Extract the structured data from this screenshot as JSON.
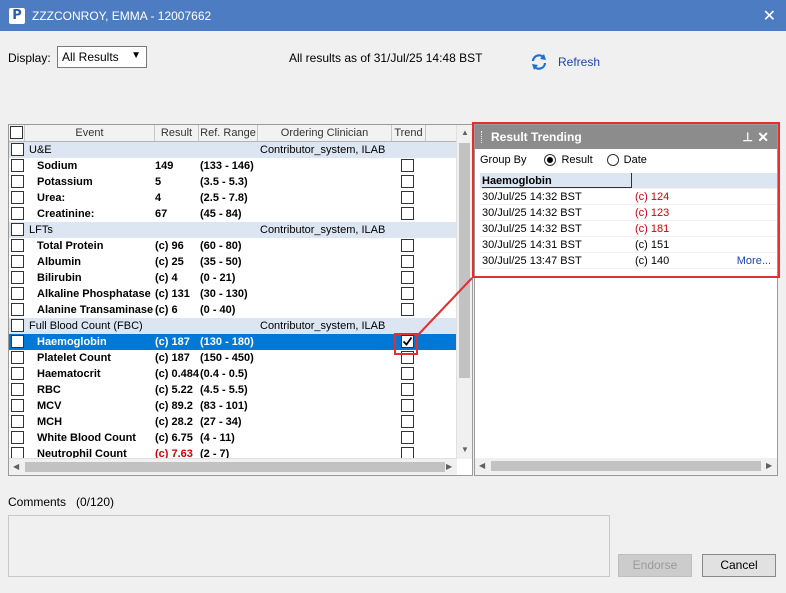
{
  "window": {
    "title": "ZZZCONROY, EMMA  - 12007662",
    "app_icon_letter": "P"
  },
  "display": {
    "label": "Display:",
    "selected": "All Results"
  },
  "status_text": "All results as of 31/Jul/25 14:48 BST",
  "refresh_label": "Refresh",
  "grid": {
    "columns": [
      "Event",
      "Result",
      "Ref. Range",
      "Ordering Clinician",
      "Trend"
    ],
    "rows": [
      {
        "type": "group",
        "event": "U&E",
        "clinician": "Contributor_system, ILAB"
      },
      {
        "type": "item",
        "event": "Sodium",
        "result": "149",
        "range": "(133 - 146)"
      },
      {
        "type": "item",
        "event": "Potassium",
        "result": "5",
        "range": "(3.5 - 5.3)"
      },
      {
        "type": "item",
        "event": "Urea:",
        "result": "4",
        "range": "(2.5 - 7.8)"
      },
      {
        "type": "item",
        "event": "Creatinine:",
        "result": "67",
        "range": "(45 - 84)"
      },
      {
        "type": "group",
        "event": "LFTs",
        "clinician": "Contributor_system, ILAB"
      },
      {
        "type": "item",
        "event": "Total Protein",
        "result": "(c) 96",
        "range": "(60 - 80)"
      },
      {
        "type": "item",
        "event": "Albumin",
        "result": "(c) 25",
        "range": "(35 - 50)"
      },
      {
        "type": "item",
        "event": "Bilirubin",
        "result": "(c) 4",
        "range": "(0 - 21)"
      },
      {
        "type": "item",
        "event": "Alkaline Phosphatase",
        "result": "(c) 131",
        "range": "(30 - 130)"
      },
      {
        "type": "item",
        "event": "Alanine Transaminase *",
        "result": "(c) 6",
        "range": "(0 - 40)"
      },
      {
        "type": "group",
        "event": "Full Blood Count (FBC)",
        "clinician": "Contributor_system, ILAB"
      },
      {
        "type": "selected",
        "event": "Haemoglobin",
        "result": "(c) 187",
        "range": "(130 - 180)"
      },
      {
        "type": "item",
        "event": "Platelet Count",
        "result": "(c) 187",
        "range": "(150 - 450)"
      },
      {
        "type": "item",
        "event": "Haematocrit",
        "result": "(c) 0.484",
        "range": "(0.4 - 0.5)"
      },
      {
        "type": "item",
        "event": "RBC",
        "result": "(c) 5.22",
        "range": "(4.5 - 5.5)"
      },
      {
        "type": "item",
        "event": "MCV",
        "result": "(c) 89.2",
        "range": "(83 - 101)"
      },
      {
        "type": "item",
        "event": "MCH",
        "result": "(c) 28.2",
        "range": "(27 - 34)"
      },
      {
        "type": "item",
        "event": "White Blood Count",
        "result": "(c) 6.75",
        "range": "(4 - 11)"
      },
      {
        "type": "item",
        "event": "Neutrophil Count",
        "result": "(c) 7.63",
        "range": "(2 - 7)",
        "result_color": "#d00000"
      }
    ]
  },
  "trending": {
    "title": "Result Trending",
    "group_by_label": "Group By",
    "option_result": "Result",
    "option_date": "Date",
    "header": "Haemoglobin",
    "rows": [
      {
        "date": "30/Jul/25 14:32 BST",
        "value": "(c) 124",
        "color": "#d00000"
      },
      {
        "date": "30/Jul/25 14:32 BST",
        "value": "(c) 123",
        "color": "#d00000"
      },
      {
        "date": "30/Jul/25 14:32 BST",
        "value": "(c) 181",
        "color": "#d00000"
      },
      {
        "date": "30/Jul/25 14:31 BST",
        "value": "(c) 151",
        "color": "#000000"
      },
      {
        "date": "30/Jul/25 13:47 BST",
        "value": "(c) 140",
        "color": "#000000"
      }
    ],
    "more_label": "More..."
  },
  "comments": {
    "label": "Comments",
    "counter": "(0/120)"
  },
  "buttons": {
    "endorse": "Endorse",
    "cancel": "Cancel"
  },
  "colors": {
    "titlebar": "#4d7cc2",
    "selection": "#0078d7",
    "group_row": "#dce6f2",
    "highlight": "#e03030",
    "abnormal": "#d00000"
  }
}
